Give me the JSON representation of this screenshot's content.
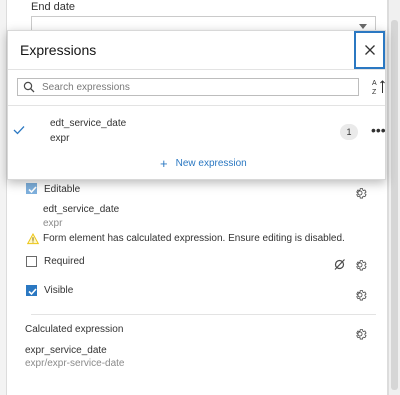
{
  "end_date": {
    "label": "End date",
    "value": ""
  },
  "popover": {
    "title": "Expressions",
    "search_placeholder": "Search expressions",
    "items": [
      {
        "name": "edt_service_date",
        "sub": "expr",
        "count": "1",
        "selected": true
      }
    ],
    "new_expression_label": "New expression"
  },
  "editable": {
    "label": "Editable",
    "checked": true,
    "expr_name": "edt_service_date",
    "expr_sub": "expr"
  },
  "warning_text": "Form element has calculated expression. Ensure editing is disabled.",
  "required": {
    "label": "Required",
    "checked": false
  },
  "visible": {
    "label": "Visible",
    "checked": true
  },
  "calculated": {
    "label": "Calculated expression",
    "expr_name": "expr_service_date",
    "expr_path": "expr/expr-service-date"
  },
  "colors": {
    "accent": "#2b78c2",
    "warning": "#edd317",
    "text": "#323232",
    "muted": "#8a8a8a"
  }
}
